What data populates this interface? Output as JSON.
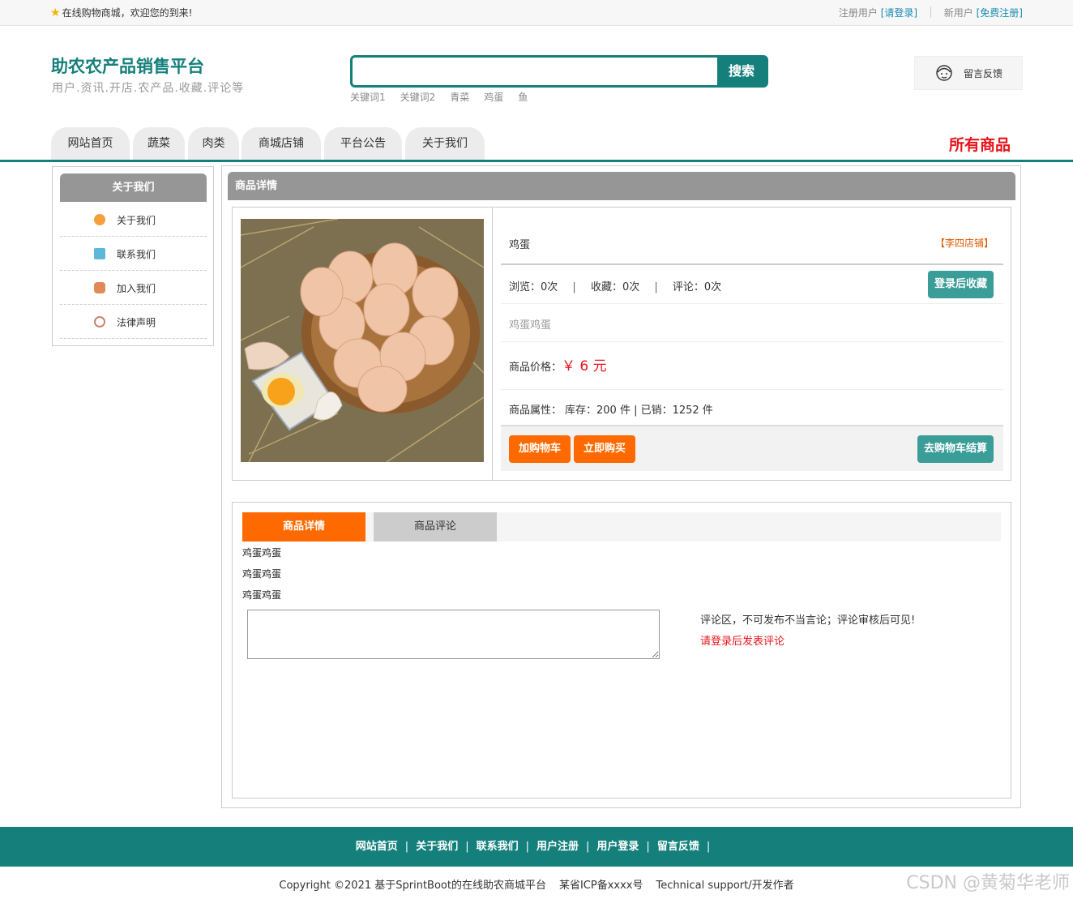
{
  "topbar": {
    "welcome": "在线购物商城，欢迎您的到来!",
    "reg_user": "注册用户",
    "login_link": "[请登录]",
    "new_user": "新用户",
    "register_link": "[免费注册]"
  },
  "header": {
    "title": "助农农产品销售平台",
    "subtitle": "用户.资讯.开店.农产品.收藏.评论等",
    "search_button": "搜索",
    "search_placeholder": "",
    "hot_words": [
      "关键词1",
      "关键词2",
      "青菜",
      "鸡蛋",
      "鱼"
    ],
    "feedback": "留言反馈"
  },
  "nav": {
    "tabs": [
      "网站首页",
      "蔬菜",
      "肉类",
      "商城店铺",
      "平台公告",
      "关于我们"
    ],
    "all_products": "所有商品"
  },
  "sidebar": {
    "title": "关于我们",
    "items": [
      {
        "label": "关于我们",
        "icon": "info-icon",
        "color": "#f5a03c"
      },
      {
        "label": "联系我们",
        "icon": "clipboard-icon",
        "color": "#5bb8d8"
      },
      {
        "label": "加入我们",
        "icon": "lock-icon",
        "color": "#e08a5a"
      },
      {
        "label": "法律声明",
        "icon": "power-icon",
        "color": "#c9836f"
      }
    ]
  },
  "product": {
    "panel_title": "商品详情",
    "name": "鸡蛋",
    "shop": "【李四店铺】",
    "views": "浏览：0次",
    "favorites": "收藏：0次",
    "comments": "评论：0次",
    "favorite_button": "登录后收藏",
    "summary": "鸡蛋鸡蛋",
    "price_label": "商品价格：",
    "price": "￥ 6 元",
    "attr_label": "商品属性：",
    "stock": "库存：200 件 | 已销：1252 件",
    "add_cart": "加购物车",
    "buy_now": "立即购买",
    "checkout": "去购物车结算"
  },
  "detail": {
    "tab_detail": "商品详情",
    "tab_comments": "商品评论",
    "lines": [
      "鸡蛋鸡蛋",
      "鸡蛋鸡蛋",
      "鸡蛋鸡蛋"
    ],
    "comment_note": "评论区，不可发布不当言论；评论审核后可见!",
    "comment_login": "请登录后发表评论"
  },
  "footer": {
    "links": [
      "网站首页",
      "关于我们",
      "联系我们",
      "用户注册",
      "用户登录",
      "留言反馈"
    ],
    "separator": "|",
    "copyright": "Copyright ©2021 基于SprintBoot的在线助农商城平台",
    "icp": "某省ICP备xxxx号",
    "support": "Technical support/开发作者"
  },
  "watermark": "CSDN @黄菊华老师",
  "colors": {
    "brand": "#15807b",
    "accent": "#ff6a00",
    "alert": "#e8141b"
  }
}
